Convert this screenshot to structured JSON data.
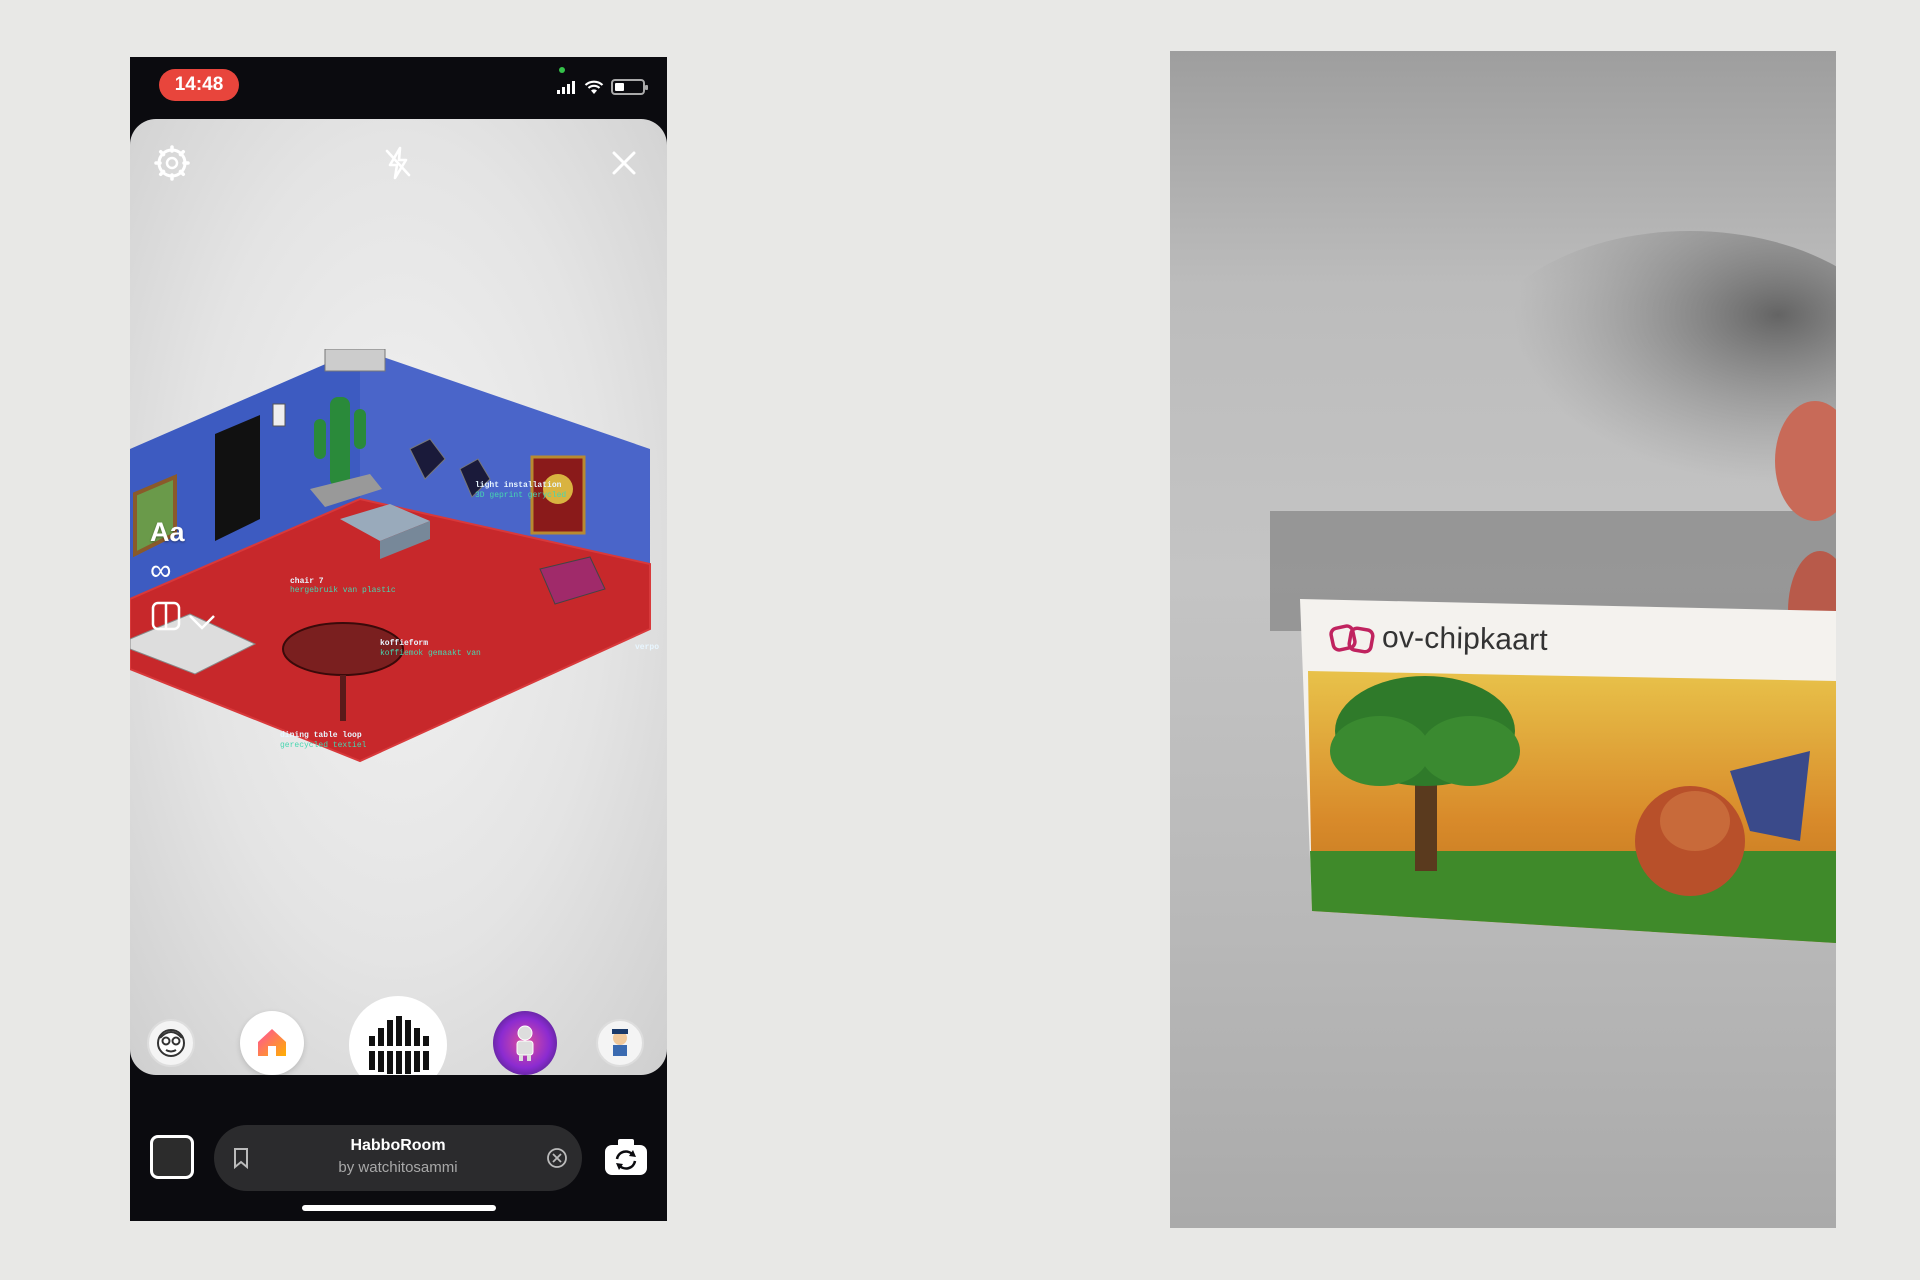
{
  "status_bar": {
    "time": "14:48",
    "indicators": [
      "cellular-signal-icon",
      "wifi-icon",
      "battery-icon"
    ]
  },
  "camera": {
    "top_icons": [
      "settings-icon",
      "flash-off-icon",
      "close-icon"
    ],
    "side_tools": {
      "text_tool_label": "Aa",
      "boomerang_label": "∞",
      "icons": [
        "layout-icon",
        "chevron-down-icon"
      ]
    },
    "lenses": [
      "face-avatar-lens",
      "home-lens",
      "capture-button",
      "robot-lens",
      "character-lens"
    ]
  },
  "effect": {
    "name": "HabboRoom",
    "author": "by watchitosammi"
  },
  "bottom_icons": [
    "gallery-thumbnail",
    "bookmark-icon",
    "clear-icon",
    "flip-camera-icon"
  ],
  "card": {
    "label": "ov-chipkaart",
    "logo": "ov-chipkaart-logo"
  },
  "colors": {
    "time_pill": "#e8453c",
    "room_floor": "#c7282b",
    "room_wall": "#3d5bc1",
    "card_logo": "#c0235f"
  }
}
